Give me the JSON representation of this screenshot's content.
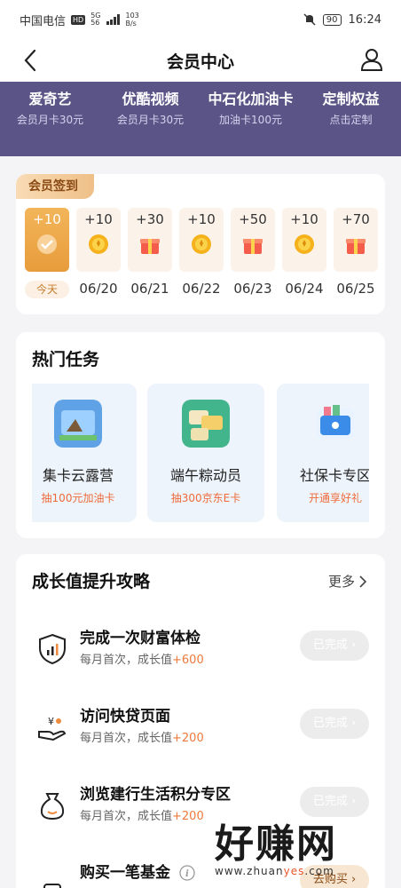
{
  "status": {
    "carrier": "中国电信",
    "hd": "HD",
    "net_top": "5G",
    "net_bottom": "56",
    "speed_value": "103",
    "speed_unit": "B/s",
    "battery": "90",
    "time": "16:24"
  },
  "header": {
    "title": "会员中心"
  },
  "banner": [
    {
      "name": "爱奇艺",
      "sub": "会员月卡30元"
    },
    {
      "name": "优酷视频",
      "sub": "会员月卡30元"
    },
    {
      "name": "中石化加油卡",
      "sub": "加油卡100元"
    },
    {
      "name": "定制权益",
      "sub": "点击定制"
    }
  ],
  "signin": {
    "tag": "会员签到",
    "days": [
      {
        "points": "+10",
        "icon": "check-icon",
        "date": "今天"
      },
      {
        "points": "+10",
        "icon": "coin-icon",
        "date": "06/20"
      },
      {
        "points": "+30",
        "icon": "gift-icon",
        "date": "06/21"
      },
      {
        "points": "+10",
        "icon": "coin-icon",
        "date": "06/22"
      },
      {
        "points": "+50",
        "icon": "gift-icon",
        "date": "06/23"
      },
      {
        "points": "+10",
        "icon": "coin-icon",
        "date": "06/24"
      },
      {
        "points": "+70",
        "icon": "gift-icon",
        "date": "06/25"
      }
    ]
  },
  "hot": {
    "title": "热门任务",
    "tasks": [
      {
        "name": "集卡云露营",
        "sub": "抽100元加油卡"
      },
      {
        "name": "端午粽动员",
        "sub": "抽300京东E卡"
      },
      {
        "name": "社保卡专区",
        "sub": "开通享好礼"
      }
    ]
  },
  "growth": {
    "title": "成长值提升攻略",
    "more": "更多",
    "items": [
      {
        "name": "完成一次财富体检",
        "sub": "每月首次，成长值",
        "plus": "+600",
        "button": "已完成",
        "icon": "shield-icon"
      },
      {
        "name": "访问快贷页面",
        "sub": "每月首次，成长值",
        "plus": "+200",
        "button": "已完成",
        "icon": "loan-hand-icon"
      },
      {
        "name": "浏览建行生活积分专区",
        "sub": "每月首次，成长值",
        "plus": "+200",
        "button": "已完成",
        "icon": "money-bag-icon"
      },
      {
        "name": "购买一笔基金",
        "sub": "",
        "plus": "",
        "button": "去购买",
        "icon": "fund-icon"
      }
    ]
  },
  "watermark": {
    "big": "好赚网",
    "url_a": "www.zhuan",
    "url_b": "yes",
    "url_c": ".com"
  }
}
